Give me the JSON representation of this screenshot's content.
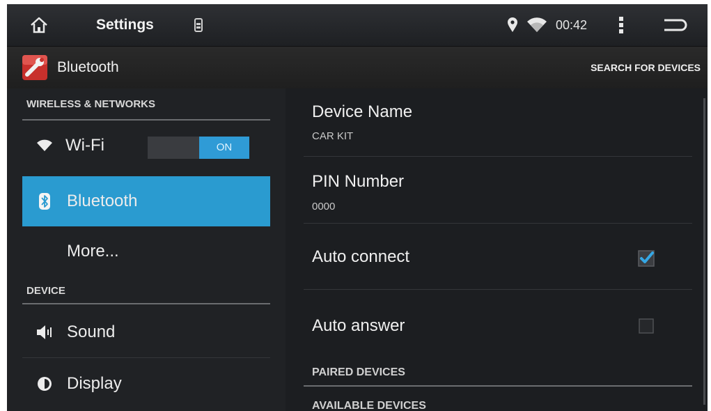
{
  "status_bar": {
    "title": "Settings",
    "clock": "00:42",
    "icons": [
      "home-icon",
      "phone-battery-icon",
      "location-pin-icon",
      "wifi-signal-icon",
      "overflow-menu-icon",
      "back-icon"
    ]
  },
  "action_bar": {
    "title": "Bluetooth",
    "action": "SEARCH FOR DEVICES",
    "icon": "settings-wrench-icon"
  },
  "sidebar": {
    "categories": [
      "WIRELESS & NETWORKS",
      "DEVICE"
    ],
    "items": [
      {
        "label": "Wi-Fi",
        "icon": "wifi-icon",
        "toggle": "ON"
      },
      {
        "label": "Bluetooth",
        "icon": "bluetooth-icon",
        "selected": true
      },
      {
        "label": "More..."
      },
      {
        "label": "Sound",
        "icon": "speaker-icon"
      },
      {
        "label": "Display",
        "icon": "brightness-icon"
      }
    ]
  },
  "detail": {
    "device_name": {
      "title": "Device Name",
      "value": "CAR KIT"
    },
    "pin": {
      "title": "PIN Number",
      "value": "0000"
    },
    "auto_connect": {
      "label": "Auto connect",
      "checked": true
    },
    "auto_answer": {
      "label": "Auto answer",
      "checked": false
    },
    "sections": [
      "PAIRED DEVICES",
      "AVAILABLE DEVICES"
    ]
  },
  "colors": {
    "accent": "#2a9bd0",
    "background": "#1c1e21",
    "divider": "#6b6d70"
  }
}
